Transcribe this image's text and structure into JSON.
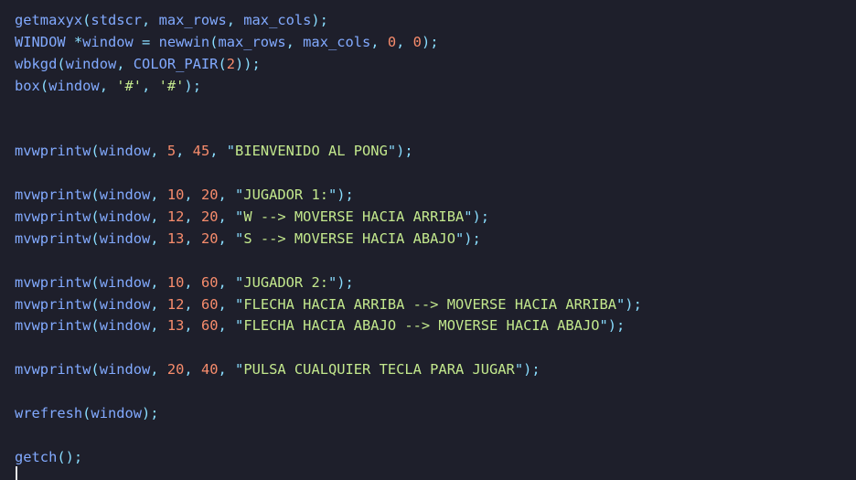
{
  "editor": {
    "colors": {
      "background": "#1e1f2b",
      "identifier": "#82aaff",
      "punctuation": "#89ddff",
      "number": "#f78c6c",
      "string": "#c3e88d",
      "cursor": "#e8e8e8"
    },
    "lines": [
      [
        {
          "t": "getmaxyx",
          "c": "fn"
        },
        {
          "t": "(",
          "c": "p"
        },
        {
          "t": "stdscr",
          "c": "fn"
        },
        {
          "t": ", ",
          "c": "p"
        },
        {
          "t": "max_rows",
          "c": "fn"
        },
        {
          "t": ", ",
          "c": "p"
        },
        {
          "t": "max_cols",
          "c": "fn"
        },
        {
          "t": ");",
          "c": "p"
        }
      ],
      [
        {
          "t": "WINDOW ",
          "c": "fn"
        },
        {
          "t": "*",
          "c": "op"
        },
        {
          "t": "window ",
          "c": "fn"
        },
        {
          "t": "= ",
          "c": "op"
        },
        {
          "t": "newwin",
          "c": "fn"
        },
        {
          "t": "(",
          "c": "p"
        },
        {
          "t": "max_rows",
          "c": "fn"
        },
        {
          "t": ", ",
          "c": "p"
        },
        {
          "t": "max_cols",
          "c": "fn"
        },
        {
          "t": ", ",
          "c": "p"
        },
        {
          "t": "0",
          "c": "n"
        },
        {
          "t": ", ",
          "c": "p"
        },
        {
          "t": "0",
          "c": "n"
        },
        {
          "t": ");",
          "c": "p"
        }
      ],
      [
        {
          "t": "wbkgd",
          "c": "fn"
        },
        {
          "t": "(",
          "c": "p"
        },
        {
          "t": "window",
          "c": "fn"
        },
        {
          "t": ", ",
          "c": "p"
        },
        {
          "t": "COLOR_PAIR",
          "c": "fn"
        },
        {
          "t": "(",
          "c": "p"
        },
        {
          "t": "2",
          "c": "n"
        },
        {
          "t": "));",
          "c": "p"
        }
      ],
      [
        {
          "t": "box",
          "c": "fn"
        },
        {
          "t": "(",
          "c": "p"
        },
        {
          "t": "window",
          "c": "fn"
        },
        {
          "t": ", ",
          "c": "p"
        },
        {
          "t": "'#'",
          "c": "s"
        },
        {
          "t": ", ",
          "c": "p"
        },
        {
          "t": "'#'",
          "c": "s"
        },
        {
          "t": ");",
          "c": "p"
        }
      ],
      [],
      [],
      [
        {
          "t": "mvwprintw",
          "c": "fn"
        },
        {
          "t": "(",
          "c": "p"
        },
        {
          "t": "window",
          "c": "fn"
        },
        {
          "t": ", ",
          "c": "p"
        },
        {
          "t": "5",
          "c": "n"
        },
        {
          "t": ", ",
          "c": "p"
        },
        {
          "t": "45",
          "c": "n"
        },
        {
          "t": ", ",
          "c": "p"
        },
        {
          "t": "\"",
          "c": "q"
        },
        {
          "t": "BIENVENIDO AL PONG",
          "c": "s"
        },
        {
          "t": "\"",
          "c": "q"
        },
        {
          "t": ");",
          "c": "p"
        }
      ],
      [],
      [
        {
          "t": "mvwprintw",
          "c": "fn"
        },
        {
          "t": "(",
          "c": "p"
        },
        {
          "t": "window",
          "c": "fn"
        },
        {
          "t": ", ",
          "c": "p"
        },
        {
          "t": "10",
          "c": "n"
        },
        {
          "t": ", ",
          "c": "p"
        },
        {
          "t": "20",
          "c": "n"
        },
        {
          "t": ", ",
          "c": "p"
        },
        {
          "t": "\"",
          "c": "q"
        },
        {
          "t": "JUGADOR 1:",
          "c": "s"
        },
        {
          "t": "\"",
          "c": "q"
        },
        {
          "t": ");",
          "c": "p"
        }
      ],
      [
        {
          "t": "mvwprintw",
          "c": "fn"
        },
        {
          "t": "(",
          "c": "p"
        },
        {
          "t": "window",
          "c": "fn"
        },
        {
          "t": ", ",
          "c": "p"
        },
        {
          "t": "12",
          "c": "n"
        },
        {
          "t": ", ",
          "c": "p"
        },
        {
          "t": "20",
          "c": "n"
        },
        {
          "t": ", ",
          "c": "p"
        },
        {
          "t": "\"",
          "c": "q"
        },
        {
          "t": "W --> MOVERSE HACIA ARRIBA",
          "c": "s"
        },
        {
          "t": "\"",
          "c": "q"
        },
        {
          "t": ");",
          "c": "p"
        }
      ],
      [
        {
          "t": "mvwprintw",
          "c": "fn"
        },
        {
          "t": "(",
          "c": "p"
        },
        {
          "t": "window",
          "c": "fn"
        },
        {
          "t": ", ",
          "c": "p"
        },
        {
          "t": "13",
          "c": "n"
        },
        {
          "t": ", ",
          "c": "p"
        },
        {
          "t": "20",
          "c": "n"
        },
        {
          "t": ", ",
          "c": "p"
        },
        {
          "t": "\"",
          "c": "q"
        },
        {
          "t": "S --> MOVERSE HACIA ABAJO",
          "c": "s"
        },
        {
          "t": "\"",
          "c": "q"
        },
        {
          "t": ");",
          "c": "p"
        }
      ],
      [],
      [
        {
          "t": "mvwprintw",
          "c": "fn"
        },
        {
          "t": "(",
          "c": "p"
        },
        {
          "t": "window",
          "c": "fn"
        },
        {
          "t": ", ",
          "c": "p"
        },
        {
          "t": "10",
          "c": "n"
        },
        {
          "t": ", ",
          "c": "p"
        },
        {
          "t": "60",
          "c": "n"
        },
        {
          "t": ", ",
          "c": "p"
        },
        {
          "t": "\"",
          "c": "q"
        },
        {
          "t": "JUGADOR 2:",
          "c": "s"
        },
        {
          "t": "\"",
          "c": "q"
        },
        {
          "t": ");",
          "c": "p"
        }
      ],
      [
        {
          "t": "mvwprintw",
          "c": "fn"
        },
        {
          "t": "(",
          "c": "p"
        },
        {
          "t": "window",
          "c": "fn"
        },
        {
          "t": ", ",
          "c": "p"
        },
        {
          "t": "12",
          "c": "n"
        },
        {
          "t": ", ",
          "c": "p"
        },
        {
          "t": "60",
          "c": "n"
        },
        {
          "t": ", ",
          "c": "p"
        },
        {
          "t": "\"",
          "c": "q"
        },
        {
          "t": "FLECHA HACIA ARRIBA --> MOVERSE HACIA ARRIBA",
          "c": "s"
        },
        {
          "t": "\"",
          "c": "q"
        },
        {
          "t": ");",
          "c": "p"
        }
      ],
      [
        {
          "t": "mvwprintw",
          "c": "fn"
        },
        {
          "t": "(",
          "c": "p"
        },
        {
          "t": "window",
          "c": "fn"
        },
        {
          "t": ", ",
          "c": "p"
        },
        {
          "t": "13",
          "c": "n"
        },
        {
          "t": ", ",
          "c": "p"
        },
        {
          "t": "60",
          "c": "n"
        },
        {
          "t": ", ",
          "c": "p"
        },
        {
          "t": "\"",
          "c": "q"
        },
        {
          "t": "FLECHA HACIA ABAJO --> MOVERSE HACIA ABAJO",
          "c": "s"
        },
        {
          "t": "\"",
          "c": "q"
        },
        {
          "t": ");",
          "c": "p"
        }
      ],
      [],
      [
        {
          "t": "mvwprintw",
          "c": "fn"
        },
        {
          "t": "(",
          "c": "p"
        },
        {
          "t": "window",
          "c": "fn"
        },
        {
          "t": ", ",
          "c": "p"
        },
        {
          "t": "20",
          "c": "n"
        },
        {
          "t": ", ",
          "c": "p"
        },
        {
          "t": "40",
          "c": "n"
        },
        {
          "t": ", ",
          "c": "p"
        },
        {
          "t": "\"",
          "c": "q"
        },
        {
          "t": "PULSA CUALQUIER TECLA PARA JUGAR",
          "c": "s"
        },
        {
          "t": "\"",
          "c": "q"
        },
        {
          "t": ");",
          "c": "p"
        }
      ],
      [],
      [
        {
          "t": "wrefresh",
          "c": "fn"
        },
        {
          "t": "(",
          "c": "p"
        },
        {
          "t": "window",
          "c": "fn"
        },
        {
          "t": ");",
          "c": "p"
        }
      ],
      [],
      [
        {
          "t": "getch",
          "c": "fn"
        },
        {
          "t": "();",
          "c": "p"
        }
      ]
    ]
  }
}
